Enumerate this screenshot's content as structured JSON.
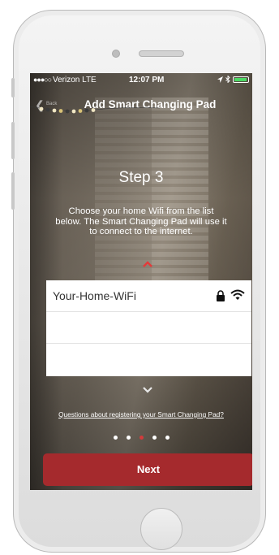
{
  "status_bar": {
    "signal": "●●●○○",
    "carrier": "Verizon  LTE",
    "time": "12:07 PM"
  },
  "nav": {
    "back_label": "Back",
    "title": "Add Smart Changing Pad"
  },
  "content": {
    "step_title": "Step 3",
    "instructions": "Choose your home Wifi from the list below. The Smart Changing Pad will use it to connect to the internet."
  },
  "wifi_list": [
    {
      "ssid": "Your-Home-WiFi",
      "secured": true
    },
    {
      "ssid": ""
    },
    {
      "ssid": ""
    }
  ],
  "help_link": "Questions about registering your Smart Changing Pad?",
  "pagination": {
    "total": 5,
    "active_index": 2
  },
  "next_button": "Next",
  "colors": {
    "accent_red": "#a52a2d",
    "chevron_red": "#e43a3a",
    "active_dot": "#d23b3b",
    "battery_green": "#4cd964"
  },
  "icons": [
    "back-chevron-icon",
    "location-arrow-icon",
    "bluetooth-icon",
    "battery-icon",
    "chevron-up-icon",
    "lock-icon",
    "wifi-icon",
    "chevron-down-icon"
  ]
}
